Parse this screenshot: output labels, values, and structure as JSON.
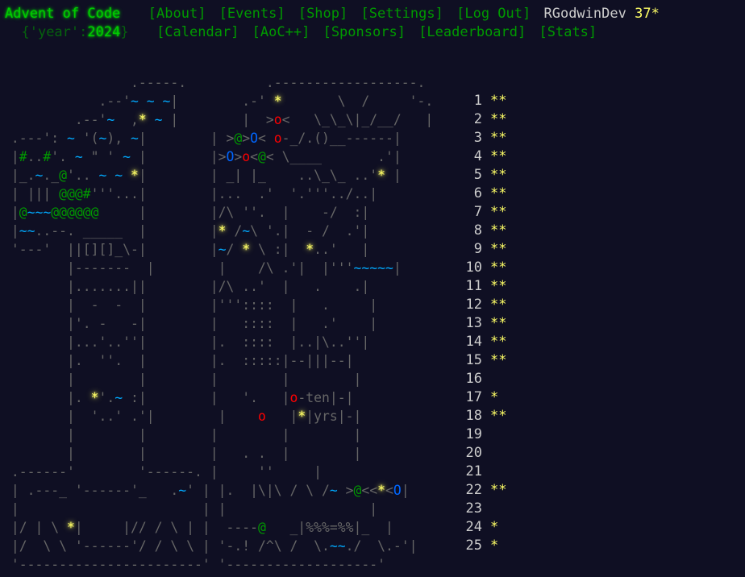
{
  "header": {
    "title": "Advent of Code",
    "nav_top": [
      "[About]",
      "[Events]",
      "[Shop]",
      "[Settings]",
      "[Log Out]"
    ],
    "username": "RGodwinDev",
    "star_count": "37*",
    "year_prefix": "{'year':",
    "year_value": "2024",
    "year_suffix": "}",
    "nav_bottom": [
      "[Calendar]",
      "[AoC++]",
      "[Sponsors]",
      "[Leaderboard]",
      "[Stats]"
    ]
  },
  "calendar_art": [
    "                .-----.          .------------------.",
    "            .--'~ ~ ~|        .-' *       \\  /     '-.",
    "         .--'~  ,* ~ |        |  >o<   \\_\\_\\|_/__/   |",
    " .---': ~ '(~), ~|        | >@>O< o-_/.()__------|",
    " |#..#'. ~ \" ' ~ |        |>O>o<@< \\____       .'|",
    " |_.~._@'.. ~ ~ *|        | _| |_    ..\\_\\_ ..'* |",
    " | ||| @@@#'''...|        |...  .'  '.'''../..|",
    " |@~~~@@@@@@     |        |/\\ ''.  |    -/  :|",
    " |~~..--. _____  |        |* /~\\ '.|  - /  .'|",
    " '---'  ||[][]_\\-|        |~/ * \\ :|  *..'   |",
    "        |-------  |        |    /\\ .'|  |'''~~~~~|",
    "        |.......||        |/\\ ..'  |   .    .|",
    "        |  -  -  |        |'''::::  |   .     |",
    "        |'. -   -|        |   ::::  |   .'    |",
    "        |...'..''|        |.  ::::  |..|\\..''|",
    "        |.  ''.  |        |.  :::::|--|||--|",
    "        |        |        |        |        |",
    "        |. *'.~ :|        |   '.   |o-ten|-|",
    "        |  '..' .'|        |    o   |*|yrs|-|",
    "        |        |        |        |        |",
    "        |        |        |   . .  |        |",
    " .------'        '------. |     ''     |",
    " | .---_ '------'_   .~' | |.  |\\|\\ / \\ /~ >@<<*<O|",
    " |                       | |                  |",
    " |/ | \\ *|     |// / \\ | |  ----@   _|%%%=%%|_  |",
    " |/  \\ \\ '------'/ / \\ \\ | '-.! /^\\ /  \\.~~./  \\.-'|",
    " '-----------------------' '-------------------'"
  ],
  "days": [
    {
      "num": "1",
      "stars": "**"
    },
    {
      "num": "2",
      "stars": "**"
    },
    {
      "num": "3",
      "stars": "**"
    },
    {
      "num": "4",
      "stars": "**"
    },
    {
      "num": "5",
      "stars": "**"
    },
    {
      "num": "6",
      "stars": "**"
    },
    {
      "num": "7",
      "stars": "**"
    },
    {
      "num": "8",
      "stars": "**"
    },
    {
      "num": "9",
      "stars": "**"
    },
    {
      "num": "10",
      "stars": "**"
    },
    {
      "num": "11",
      "stars": "**"
    },
    {
      "num": "12",
      "stars": "**"
    },
    {
      "num": "13",
      "stars": "**"
    },
    {
      "num": "14",
      "stars": "**"
    },
    {
      "num": "15",
      "stars": "**"
    },
    {
      "num": "16",
      "stars": ""
    },
    {
      "num": "17",
      "stars": "*"
    },
    {
      "num": "18",
      "stars": "**"
    },
    {
      "num": "19",
      "stars": ""
    },
    {
      "num": "20",
      "stars": ""
    },
    {
      "num": "21",
      "stars": ""
    },
    {
      "num": "22",
      "stars": "**"
    },
    {
      "num": "23",
      "stars": ""
    },
    {
      "num": "24",
      "stars": "*"
    },
    {
      "num": "25",
      "stars": "*"
    }
  ],
  "colors": {
    "background": "#0f0f23",
    "title_green": "#00cc00",
    "link_green": "#009900",
    "star_yellow": "#ffff66",
    "text_gray": "#cccccc"
  }
}
